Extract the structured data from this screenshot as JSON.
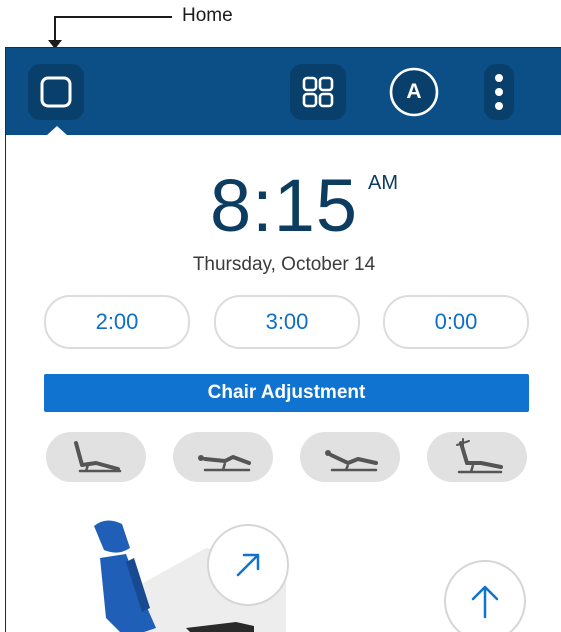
{
  "annotation": {
    "label": "Home"
  },
  "topbar": {
    "home_icon": "home-square-icon",
    "apps_icon": "grid-icon",
    "avatar_letter": "A",
    "more_icon": "more-vertical-icon"
  },
  "clock": {
    "time": "8:15",
    "ampm": "AM",
    "date": "Thursday, October 14"
  },
  "timers": [
    "2:00",
    "3:00",
    "0:00"
  ],
  "chair_adjustment_label": "Chair Adjustment",
  "presets": [
    "preset-upright-icon",
    "preset-recline-icon",
    "preset-flat-icon",
    "preset-trendelenburg-icon"
  ],
  "colors": {
    "topbar": "#0b4f86",
    "accent": "#1073cf",
    "time_text": "#0d3c61",
    "chair_blue": "#1f5fb8"
  }
}
